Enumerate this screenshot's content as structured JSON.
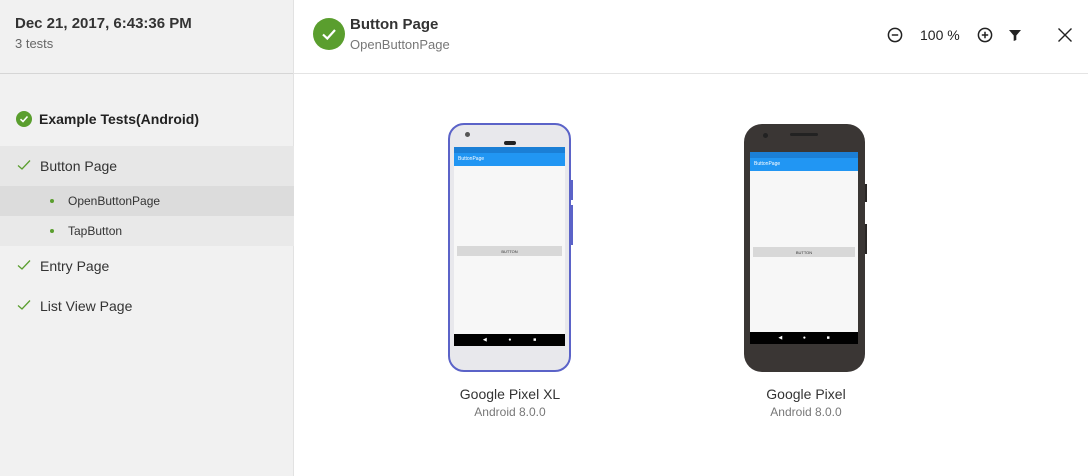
{
  "sidebar": {
    "run_date": "Dec 21, 2017, 6:43:36 PM",
    "test_count": "3 tests",
    "suite_title": "Example Tests(Android)",
    "groups": [
      {
        "label": "Button Page",
        "steps": [
          "OpenButtonPage",
          "TapButton"
        ]
      },
      {
        "label": "Entry Page"
      },
      {
        "label": "List View Page"
      }
    ]
  },
  "main": {
    "title": "Button Page",
    "subtitle": "OpenButtonPage",
    "toolbar": {
      "zoom_out_icon": "zoom-out-icon",
      "zoom_level": "100 %",
      "zoom_in_icon": "zoom-in-icon",
      "filter_icon": "filter-icon",
      "close_icon": "close-icon"
    },
    "devices": [
      {
        "name": "Google Pixel XL",
        "os": "Android 8.0.0",
        "app_title": "ButtonPage",
        "button_label": "BUTTON",
        "frame_color": "#e8e8ec",
        "selected": true
      },
      {
        "name": "Google Pixel",
        "os": "Android 8.0.0",
        "app_title": "ButtonPage",
        "button_label": "BUTTON",
        "frame_color": "#3a3634",
        "selected": false
      }
    ]
  },
  "colors": {
    "pass_green": "#5a9e2e",
    "selection_border": "#5b63c8",
    "app_bar_blue": "#2196f3"
  }
}
